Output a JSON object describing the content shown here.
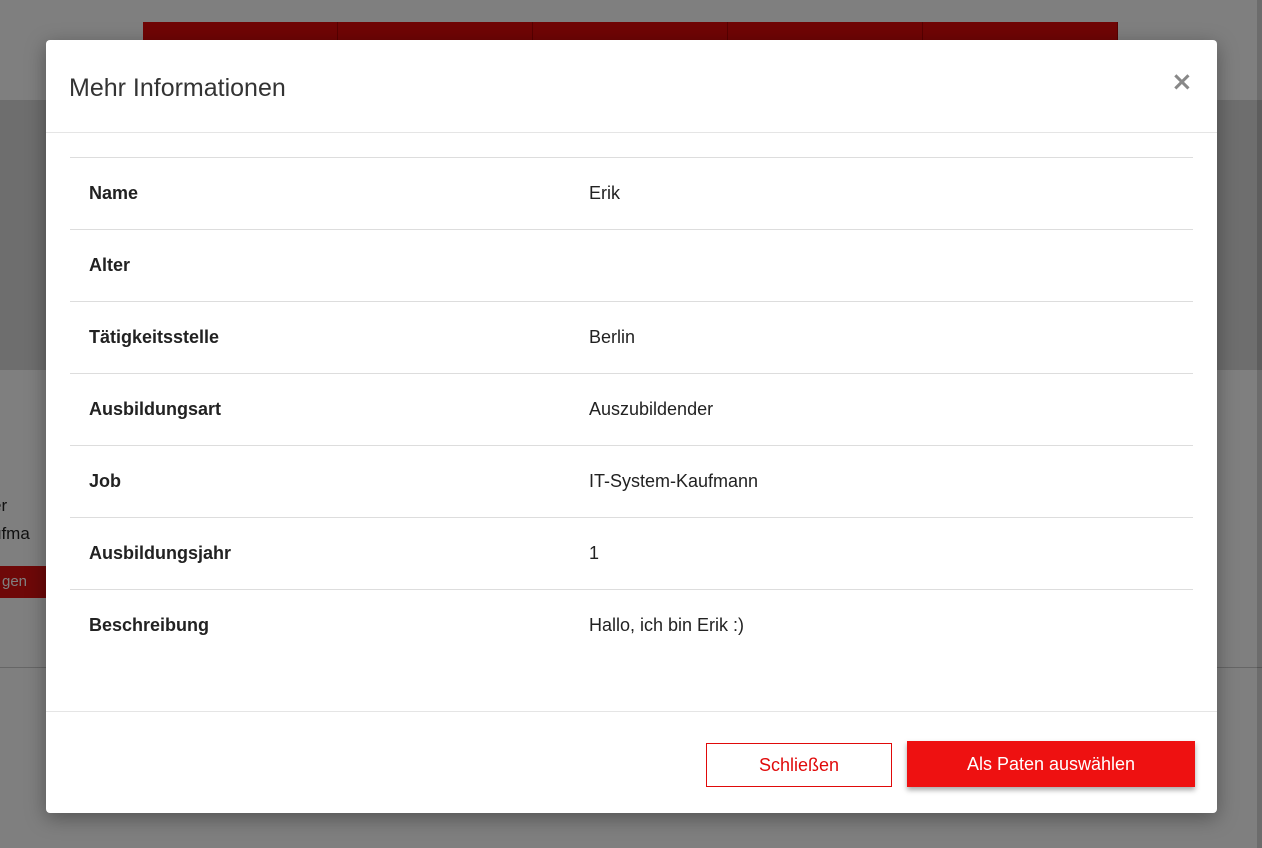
{
  "background": {
    "card_text_line1": "er",
    "card_text_line2": "ufma",
    "card_button_label": "gen"
  },
  "modal": {
    "title": "Mehr Informationen",
    "close_icon": "×",
    "rows": [
      {
        "label": "Name",
        "value": "Erik"
      },
      {
        "label": "Alter",
        "value": ""
      },
      {
        "label": "Tätigkeitsstelle",
        "value": "Berlin"
      },
      {
        "label": "Ausbildungsart",
        "value": "Auszubildender"
      },
      {
        "label": "Job",
        "value": "IT-System-Kaufmann"
      },
      {
        "label": "Ausbildungsjahr",
        "value": "1"
      },
      {
        "label": "Beschreibung",
        "value": "Hallo, ich bin Erik :)"
      }
    ],
    "footer": {
      "close_label": "Schließen",
      "select_label": "Als Paten auswählen"
    }
  },
  "colors": {
    "accent": "#ee1111",
    "overlay": "rgba(0,0,0,0.5)"
  }
}
